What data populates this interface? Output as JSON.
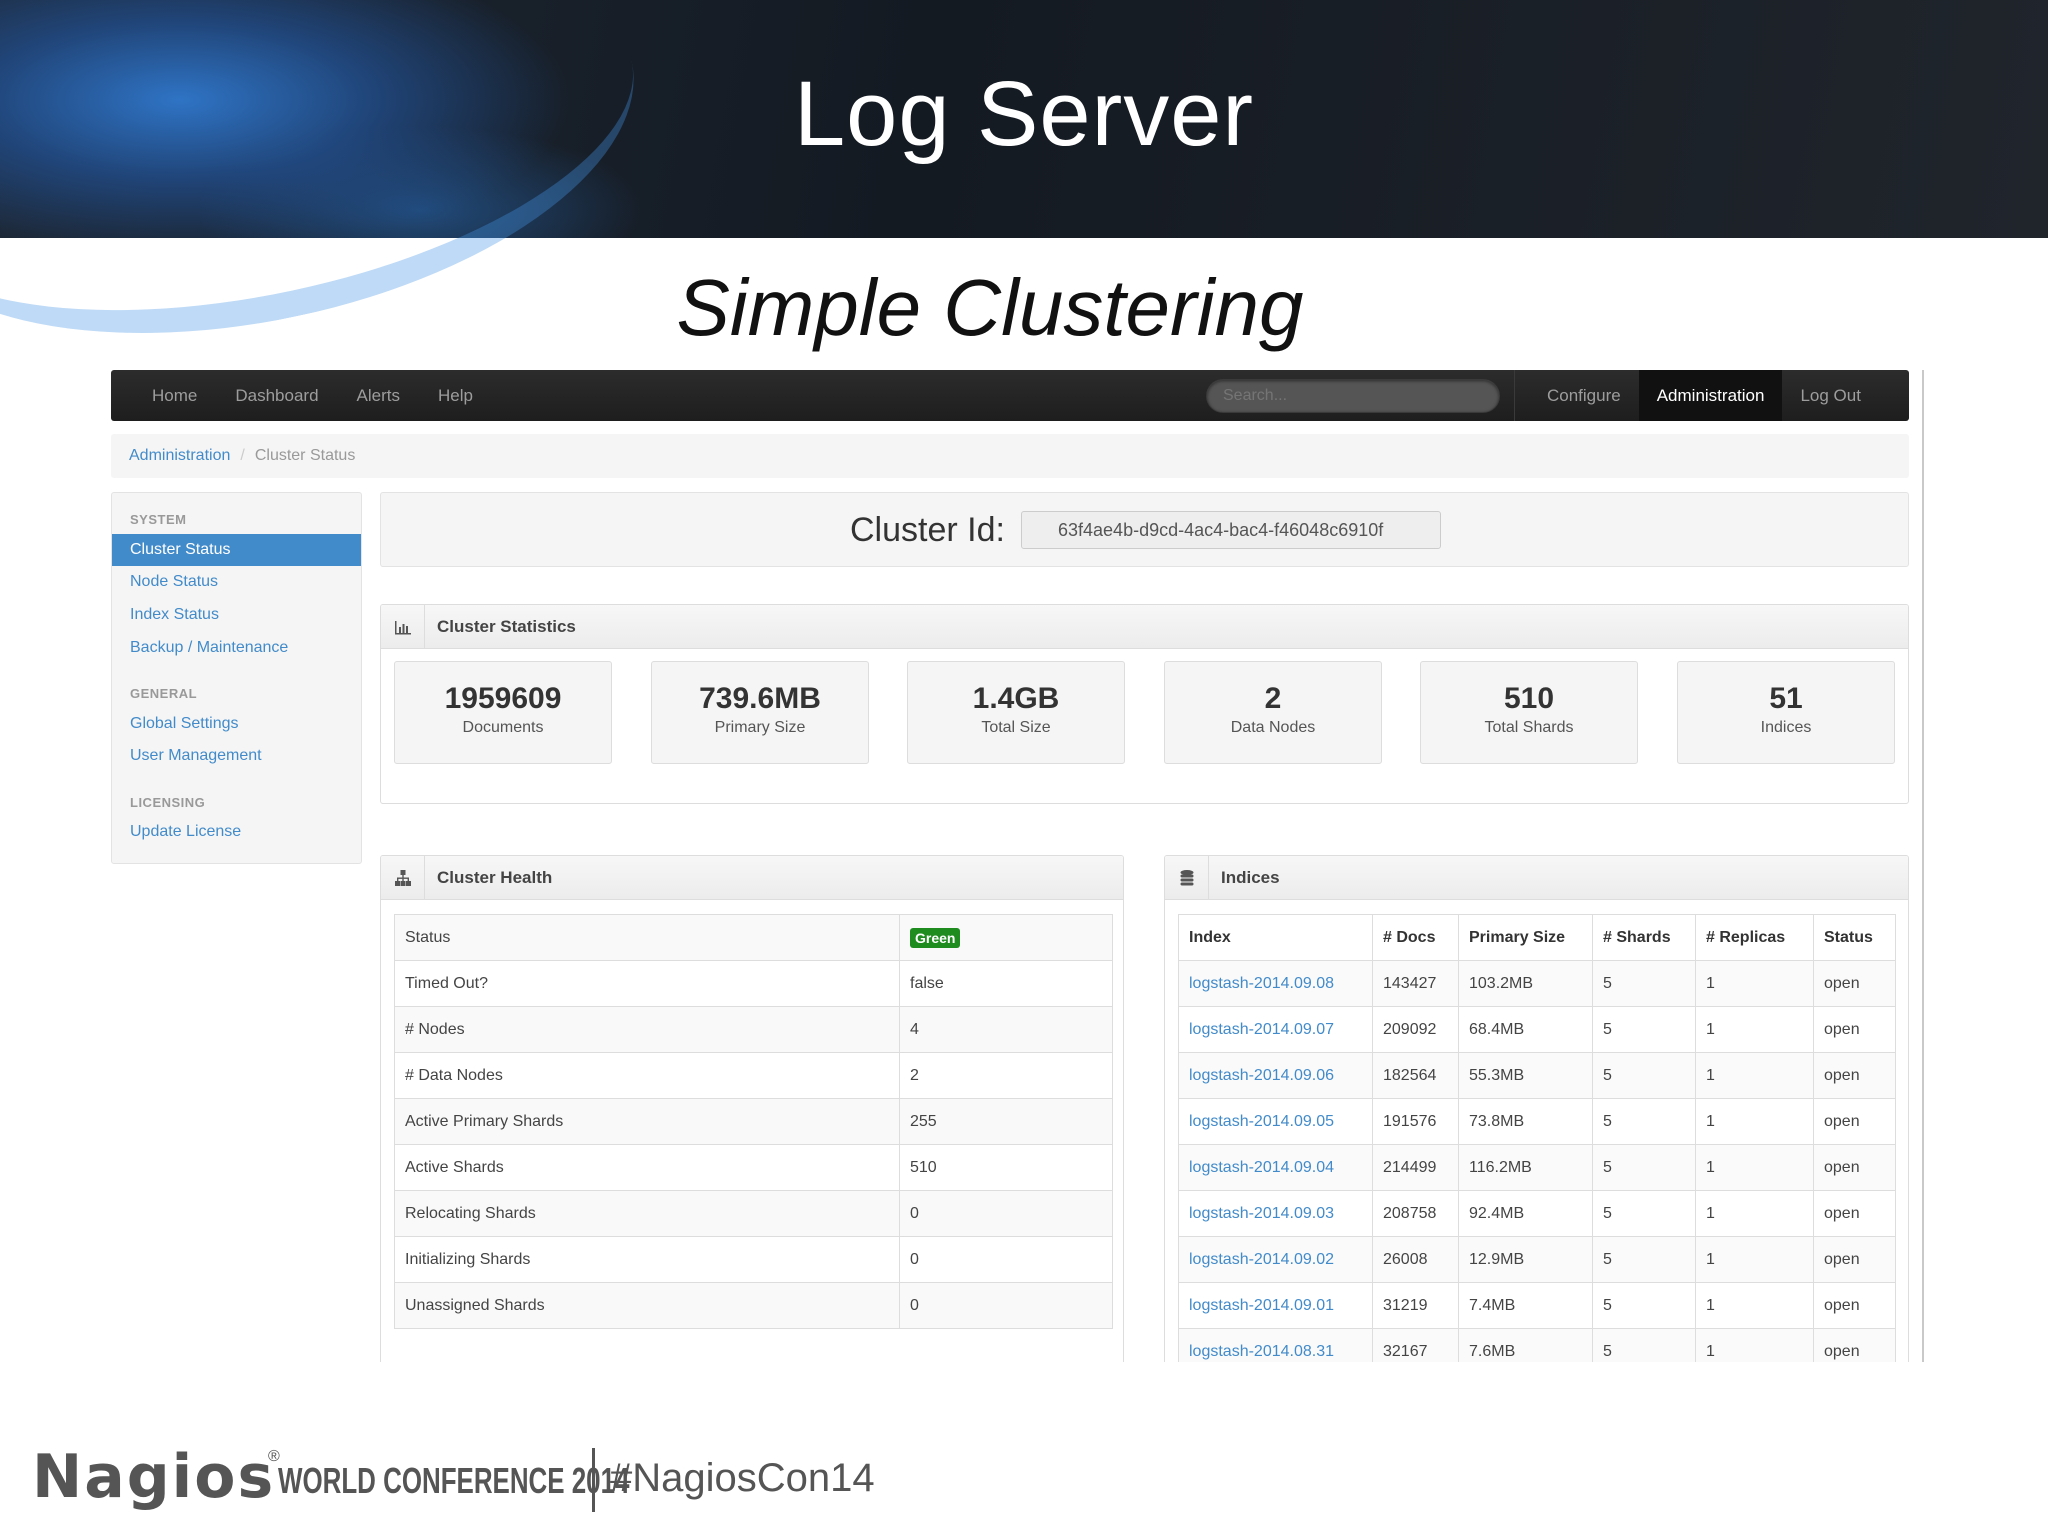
{
  "slide": {
    "title": "Log Server",
    "subtitle": "Simple Clustering"
  },
  "navbar": {
    "left": [
      "Home",
      "Dashboard",
      "Alerts",
      "Help"
    ],
    "search_placeholder": "Search...",
    "right": [
      {
        "label": "Configure",
        "active": false
      },
      {
        "label": "Administration",
        "active": true
      },
      {
        "label": "Log Out",
        "active": false
      }
    ]
  },
  "breadcrumb": {
    "parent": "Administration",
    "separator": "/",
    "current": "Cluster Status"
  },
  "sidebar": {
    "sections": [
      {
        "header": "SYSTEM",
        "items": [
          {
            "label": "Cluster Status",
            "active": true
          },
          {
            "label": "Node Status",
            "active": false
          },
          {
            "label": "Index Status",
            "active": false
          },
          {
            "label": "Backup / Maintenance",
            "active": false
          }
        ]
      },
      {
        "header": "GENERAL",
        "items": [
          {
            "label": "Global Settings",
            "active": false
          },
          {
            "label": "User Management",
            "active": false
          }
        ]
      },
      {
        "header": "LICENSING",
        "items": [
          {
            "label": "Update License",
            "active": false
          }
        ]
      }
    ]
  },
  "cluster": {
    "label": "Cluster Id:",
    "id": "63f4ae4b-d9cd-4ac4-bac4-f46048c6910f"
  },
  "statistics": {
    "title": "Cluster Statistics",
    "items": [
      {
        "value": "1959609",
        "label": "Documents"
      },
      {
        "value": "739.6MB",
        "label": "Primary Size"
      },
      {
        "value": "1.4GB",
        "label": "Total Size"
      },
      {
        "value": "2",
        "label": "Data Nodes"
      },
      {
        "value": "510",
        "label": "Total Shards"
      },
      {
        "value": "51",
        "label": "Indices"
      }
    ]
  },
  "health": {
    "title": "Cluster Health",
    "rows": [
      {
        "key": "Status",
        "value": "Green",
        "badge": true
      },
      {
        "key": "Timed Out?",
        "value": "false"
      },
      {
        "key": "# Nodes",
        "value": "4"
      },
      {
        "key": "# Data Nodes",
        "value": "2"
      },
      {
        "key": "Active Primary Shards",
        "value": "255"
      },
      {
        "key": "Active Shards",
        "value": "510"
      },
      {
        "key": "Relocating Shards",
        "value": "0"
      },
      {
        "key": "Initializing Shards",
        "value": "0"
      },
      {
        "key": "Unassigned Shards",
        "value": "0"
      }
    ]
  },
  "indices": {
    "title": "Indices",
    "columns": [
      "Index",
      "# Docs",
      "Primary Size",
      "# Shards",
      "# Replicas",
      "Status"
    ],
    "rows": [
      [
        "logstash-2014.09.08",
        "143427",
        "103.2MB",
        "5",
        "1",
        "open"
      ],
      [
        "logstash-2014.09.07",
        "209092",
        "68.4MB",
        "5",
        "1",
        "open"
      ],
      [
        "logstash-2014.09.06",
        "182564",
        "55.3MB",
        "5",
        "1",
        "open"
      ],
      [
        "logstash-2014.09.05",
        "191576",
        "73.8MB",
        "5",
        "1",
        "open"
      ],
      [
        "logstash-2014.09.04",
        "214499",
        "116.2MB",
        "5",
        "1",
        "open"
      ],
      [
        "logstash-2014.09.03",
        "208758",
        "92.4MB",
        "5",
        "1",
        "open"
      ],
      [
        "logstash-2014.09.02",
        "26008",
        "12.9MB",
        "5",
        "1",
        "open"
      ],
      [
        "logstash-2014.09.01",
        "31219",
        "7.4MB",
        "5",
        "1",
        "open"
      ],
      [
        "logstash-2014.08.31",
        "32167",
        "7.6MB",
        "5",
        "1",
        "open"
      ]
    ]
  },
  "footer": {
    "logo": "Nagios",
    "registered": "®",
    "conference": "WORLD CONFERENCE 2014",
    "hashtag": "#NagiosCon14"
  },
  "colors": {
    "link": "#428bca",
    "active_item": "#428bca",
    "navbar": "#222222",
    "badge_green": "#1f8c1f"
  }
}
